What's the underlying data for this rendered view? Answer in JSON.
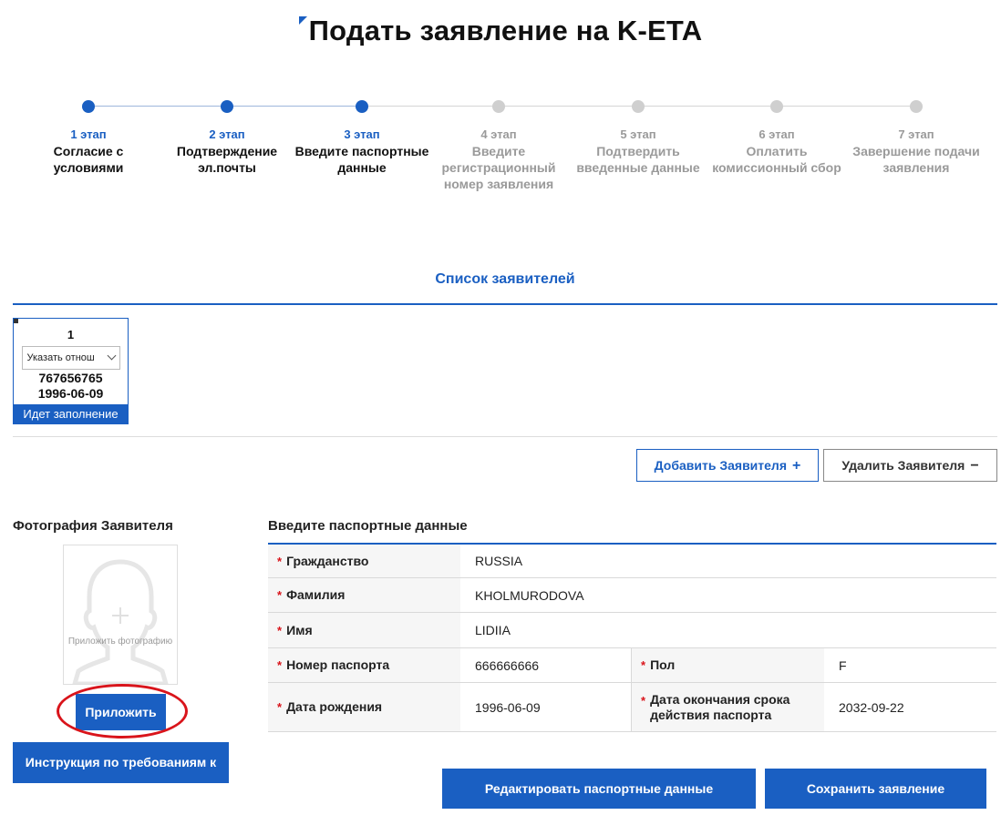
{
  "page": {
    "title": "Подать заявление на K-ETA"
  },
  "steps": [
    {
      "num": "1 этап",
      "label": "Согласие с условиями",
      "state": "done"
    },
    {
      "num": "2 этап",
      "label": "Подтверждение эл.почты",
      "state": "done"
    },
    {
      "num": "3 этап",
      "label": "Введите паспортные данные",
      "state": "current"
    },
    {
      "num": "4 этап",
      "label": "Введите регистрационный номер заявления",
      "state": "todo"
    },
    {
      "num": "5 этап",
      "label": "Подтвердить введенные данные",
      "state": "todo"
    },
    {
      "num": "6 этап",
      "label": "Оплатить комиссионный сбор",
      "state": "todo"
    },
    {
      "num": "7 этап",
      "label": "Завершение подачи заявления",
      "state": "todo"
    }
  ],
  "applicants": {
    "title": "Список заявителей",
    "cards": [
      {
        "number": "1",
        "relation_select": "Указать отнош",
        "passport": "767656765",
        "birth": "1996-06-09",
        "status": "Идет заполнение"
      }
    ],
    "add_label": "Добавить Заявителя",
    "add_symbol": "+",
    "remove_label": "Удалить Заявителя",
    "remove_symbol": "−"
  },
  "photo": {
    "title": "Фотография Заявителя",
    "hint": "Приложить фотографию",
    "attach_label": "Приложить",
    "instructions_label": "Инструкция по требованиям к"
  },
  "passport": {
    "title": "Введите паспортные данные",
    "required_mark": "*",
    "fields": {
      "citizenship": {
        "label": "Гражданство",
        "value": "RUSSIA"
      },
      "surname": {
        "label": "Фамилия",
        "value": "KHOLMURODOVA"
      },
      "name": {
        "label": "Имя",
        "value": "LIDIIA"
      },
      "passport_no": {
        "label": "Номер паспорта",
        "value": "666666666"
      },
      "sex": {
        "label": "Пол",
        "value": "F"
      },
      "birth_date": {
        "label": "Дата рождения",
        "value": "1996-06-09"
      },
      "expiry": {
        "label": "Дата окончания срока действия паспорта",
        "value": "2032-09-22"
      }
    }
  },
  "actions": {
    "edit_label": "Редактировать паспортные данные",
    "save_label": "Сохранить заявление"
  },
  "colors": {
    "accent": "#1a5fc2",
    "required": "#d9141b",
    "inactive": "#cfcfcf"
  }
}
